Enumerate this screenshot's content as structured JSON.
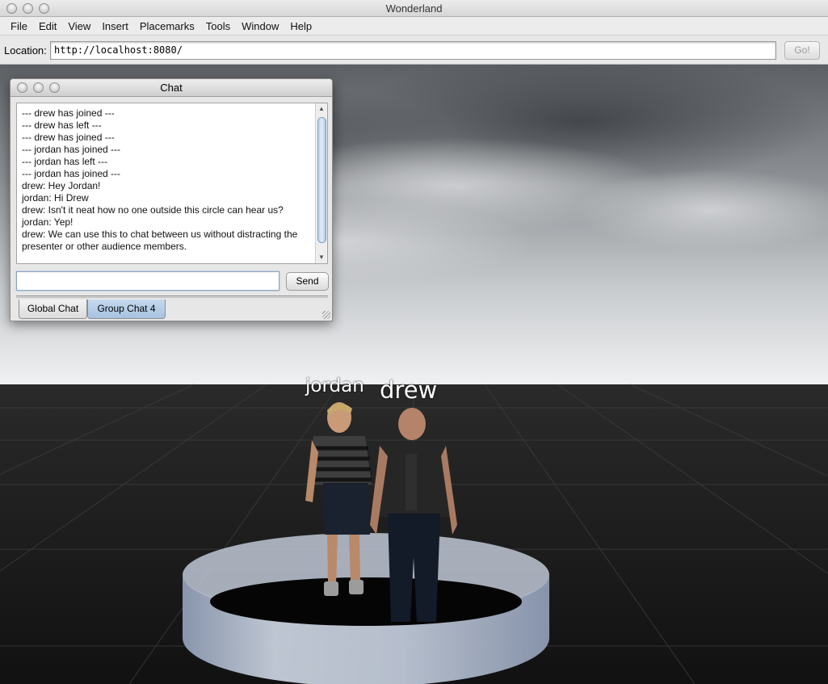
{
  "window": {
    "title": "Wonderland"
  },
  "menu": [
    "File",
    "Edit",
    "View",
    "Insert",
    "Placemarks",
    "Tools",
    "Window",
    "Help"
  ],
  "location": {
    "label": "Location:",
    "value": "http://localhost:8080/",
    "go_label": "Go!"
  },
  "chat": {
    "title": "Chat",
    "lines": [
      "--- drew has joined ---",
      "--- drew has left ---",
      "--- drew has joined ---",
      "--- jordan has joined ---",
      "--- jordan has left ---",
      "--- jordan has joined ---",
      "drew: Hey Jordan!",
      "jordan: Hi Drew",
      "drew: Isn't it neat how no one outside this circle can hear us?",
      "jordan: Yep!",
      "drew: We can use this to chat between us without distracting the presenter or other audience members."
    ],
    "input_value": "",
    "send_label": "Send",
    "tabs": [
      {
        "label": "Global Chat",
        "active": false
      },
      {
        "label": "Group Chat 4",
        "active": true
      }
    ]
  },
  "avatars": [
    {
      "name": "jordan"
    },
    {
      "name": "drew"
    }
  ]
}
